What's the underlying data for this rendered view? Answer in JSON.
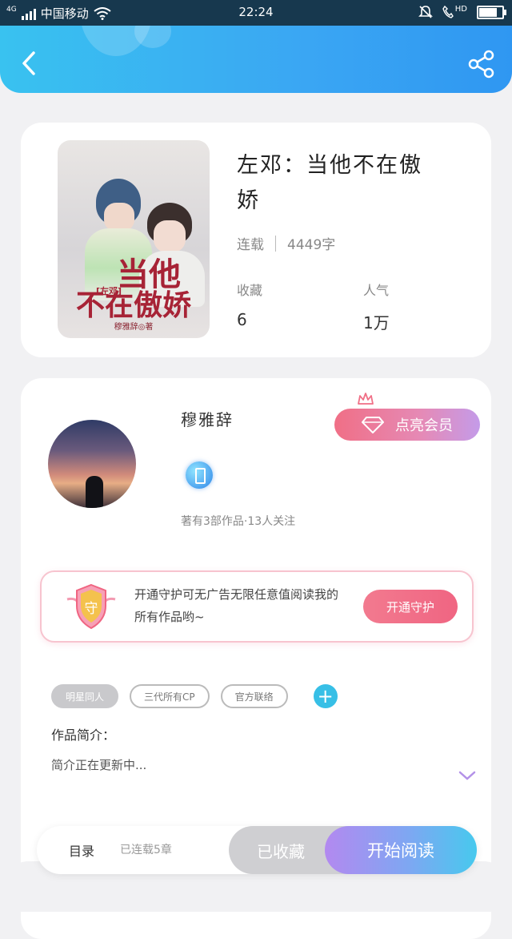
{
  "status_bar": {
    "network": "4G",
    "carrier": "中国移动",
    "time": "22:24",
    "hd_label": "HD",
    "battery_level": 0.9
  },
  "header": {
    "back_icon": "chevron-left-icon",
    "share_icon": "share-icon"
  },
  "book": {
    "cover": {
      "title_line1": "当他",
      "title_line2": "不在傲娇",
      "tag": "[左邓]",
      "author_line": "穆雅辞◎著"
    },
    "title": "左邓：当他不在傲娇",
    "status": "连载",
    "word_count": "4449字",
    "favorites_label": "收藏",
    "favorites_value": "6",
    "popularity_label": "人气",
    "popularity_value": "1万"
  },
  "author": {
    "name": "穆雅辞",
    "stats": "著有3部作品·13人关注",
    "vip_button_label": "点亮会员",
    "guard_text": "开通守护可无广告无限任意值阅读我的所有作品哟~",
    "guard_shield_char": "守",
    "guard_button_label": "开通守护",
    "tags": [
      "明星同人",
      "三代所有CP",
      "官方联络"
    ],
    "add_tag_symbol": "+",
    "intro_label": "作品简介：",
    "intro_text": "简介正在更新中..."
  },
  "bottom_bar": {
    "toc_label": "目录",
    "chapters_label": "已连载5章",
    "collect_label": "已收藏",
    "read_label": "开始阅读"
  },
  "colors": {
    "header_start": "#39c2f0",
    "header_end": "#2f97f2",
    "vip_gradient_start": "#f06f86",
    "vip_gradient_end": "#c49be9",
    "read_gradient_start": "#b389f0",
    "read_gradient_end": "#47c9ee",
    "accent_blue": "#37bfe6"
  }
}
